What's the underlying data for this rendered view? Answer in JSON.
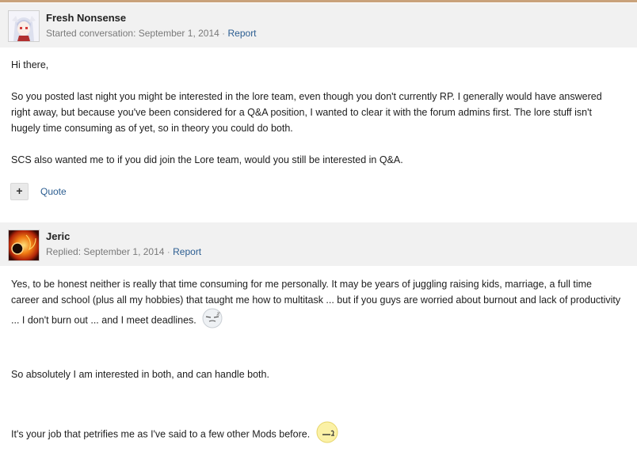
{
  "post1": {
    "username": "Fresh Nonsense",
    "meta_prefix": "Started conversation: September 1, 2014",
    "separator": "·",
    "report_label": "Report",
    "paragraphs": [
      "Hi there,",
      "So you posted last night you might be interested in the lore team, even though you don't currently RP. I generally would have answered right away, but because you've been considered for a Q&A position, I wanted to clear it with the forum admins first. The lore stuff isn't hugely time consuming as of yet, so in theory you could do both.",
      "SCS also wanted me to if you did join the Lore team, would you still be interested in Q&A."
    ],
    "plus_label": "+",
    "quote_label": "Quote"
  },
  "post2": {
    "username": "Jeric",
    "meta_prefix": "Replied: September 1, 2014",
    "separator": "·",
    "report_label": "Report",
    "paragraph1": "Yes, to be honest neither is really that time consuming for me personally. It may be years of juggling raising kids, marriage, a full time career and school (plus all my hobbies) that taught me how to multitask ... but if you guys are worried about burnout and lack of productivity ... I don't burn out ... and I meet deadlines.",
    "paragraph2": "So absolutely I am interested in both, and can handle both.",
    "paragraph3": "It's your job that petrifies me as I've said to a few other Mods before."
  },
  "icons": {
    "avatar1": "anime-girl-avatar",
    "avatar2": "fiery-eclipse-avatar",
    "emoji1": "sleepy-face-emoji",
    "emoji2": "worried-face-emoji"
  },
  "colors": {
    "header_bg": "#f1f1f1",
    "link": "#2b5d91",
    "meta": "#7a7a7a"
  }
}
